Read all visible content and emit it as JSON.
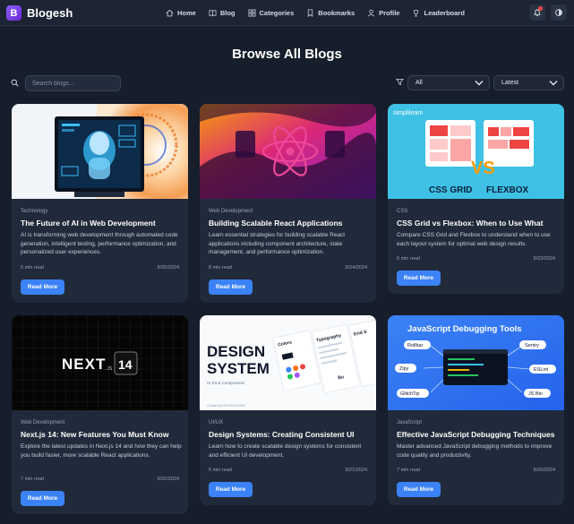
{
  "brand": {
    "name": "Blogesh",
    "logo_letter": "B",
    "color": "#7c3aed"
  },
  "nav": {
    "links": [
      {
        "label": "Home",
        "icon": "home-icon"
      },
      {
        "label": "Blog",
        "icon": "book-icon"
      },
      {
        "label": "Categories",
        "icon": "grid-icon"
      },
      {
        "label": "Bookmarks",
        "icon": "bookmark-icon"
      },
      {
        "label": "Profile",
        "icon": "user-icon"
      },
      {
        "label": "Leaderboard",
        "icon": "trophy-icon"
      }
    ],
    "right": [
      "bell-icon",
      "theme-toggle-icon"
    ]
  },
  "page": {
    "title": "Browse All Blogs"
  },
  "search": {
    "placeholder": "Search blogs..."
  },
  "filters": {
    "category": "All",
    "sort": "Latest"
  },
  "accent": "#3b82f6",
  "cards": [
    {
      "category": "Technology",
      "title": "The Future of AI in Web Development",
      "description": "AI is transforming web development through automated code generation, intelligent testing, performance optimization, and personalized user experiences.",
      "read_time": "5 min read",
      "date": "9/25/2024",
      "button": "Read More"
    },
    {
      "category": "Web Development",
      "title": "Building Scalable React Applications",
      "description": "Learn essential strategies for building scalable React applications including component architecture, state management, and performance optimization.",
      "read_time": "8 min read",
      "date": "9/24/2024",
      "button": "Read More"
    },
    {
      "category": "CSS",
      "title": "CSS Grid vs Flexbox: When to Use What",
      "description": "Compare CSS Grid and Flexbox to understand when to use each layout system for optimal web design results.",
      "read_time": "6 min read",
      "date": "9/23/2024",
      "button": "Read More",
      "image": {
        "brand": "simplilearn",
        "left_label": "CSS GRID",
        "vs": "VS",
        "right_label": "FLEXBOX"
      }
    },
    {
      "category": "Web Development",
      "title": "Next.js 14: New Features You Must Know",
      "description": "Explore the latest updates in Next.js 14 and how they can help you build faster, more scalable React applications.",
      "read_time": "7 min read",
      "date": "9/22/2024",
      "button": "Read More",
      "image": {
        "logo": "NEXT",
        "sub": ".JS",
        "version": "14"
      }
    },
    {
      "category": "UI/UX",
      "title": "Design Systems: Creating Consistent UI",
      "description": "Learn how to create scalable design systems for consistent and efficient UI development.",
      "read_time": "6 min read",
      "date": "9/21/2024",
      "button": "Read More",
      "image": {
        "line1": "DESIGN",
        "line2": "SYSTEM",
        "sub": "UI Kit & Components",
        "credit": "Created by SEVENSTUDIO",
        "panel1": "Colors",
        "panel2": "Typography",
        "panel3": "Grid S",
        "panel4": "Bu"
      }
    },
    {
      "category": "JavaScript",
      "title": "Effective JavaScript Debugging Techniques",
      "description": "Master advanced JavaScript debugging methods to improve code quality and productivity.",
      "read_time": "7 min read",
      "date": "9/20/2024",
      "button": "Read More",
      "image": {
        "heading": "JavaScript Debugging Tools",
        "tags": [
          "Rollbar",
          "Sentry",
          "Zipy",
          "ESLint",
          "GlitchTip",
          "JS Bin"
        ]
      }
    }
  ]
}
